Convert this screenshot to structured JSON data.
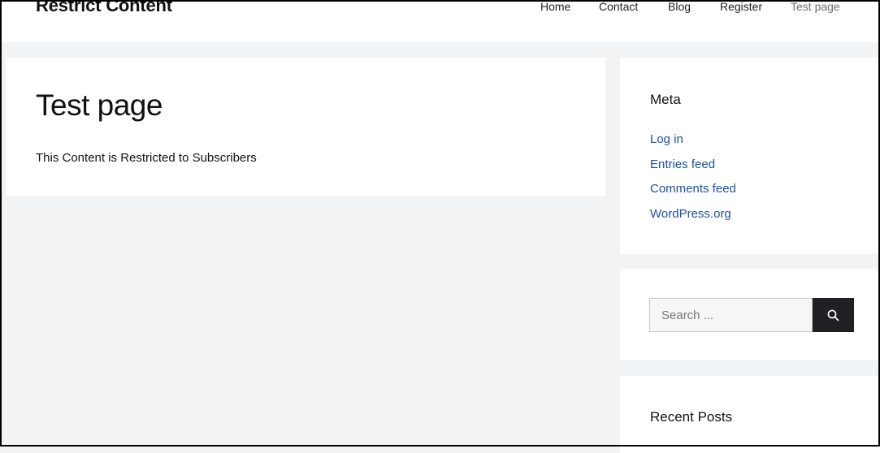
{
  "header": {
    "site_title": "Restrict Content",
    "nav": [
      {
        "label": "Home"
      },
      {
        "label": "Contact"
      },
      {
        "label": "Blog"
      },
      {
        "label": "Register"
      },
      {
        "label": "Test page"
      }
    ]
  },
  "main": {
    "title": "Test page",
    "body": "This Content is Restricted to Subscribers"
  },
  "sidebar": {
    "meta": {
      "title": "Meta",
      "links": [
        {
          "label": "Log in"
        },
        {
          "label": "Entries feed"
        },
        {
          "label": "Comments feed"
        },
        {
          "label": "WordPress.org"
        }
      ]
    },
    "search": {
      "placeholder": "Search ...",
      "button_icon": "search-icon"
    },
    "recent": {
      "title": "Recent Posts"
    }
  },
  "colors": {
    "link": "#1e4fa3",
    "background": "#f2f3f4",
    "search_button": "#1f1f24"
  }
}
